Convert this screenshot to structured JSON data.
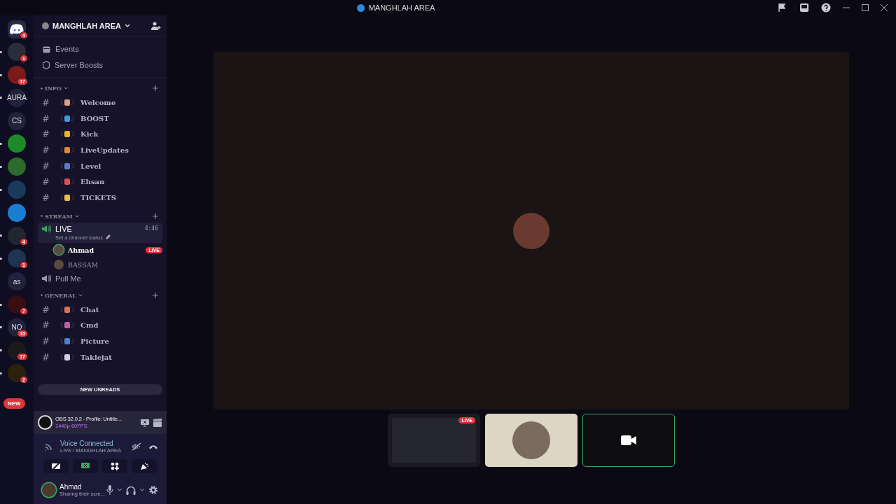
{
  "window": {
    "title": "MANGHLAH AREA"
  },
  "servers": [
    {
      "kind": "home",
      "badge": "4",
      "unread": false
    },
    {
      "kind": "image",
      "color": "#2a2d3a",
      "badge": "1",
      "unread": true
    },
    {
      "kind": "image",
      "color": "#7a1a1a",
      "badge": "17",
      "unread": true
    },
    {
      "kind": "text",
      "label": "AURA",
      "unread": true
    },
    {
      "kind": "text",
      "label": "CS",
      "unread": false
    },
    {
      "kind": "image",
      "color": "#1f8a2a",
      "unread": true
    },
    {
      "kind": "image",
      "color": "#2d6a2d",
      "unread": true
    },
    {
      "kind": "image",
      "color": "#1b3a5a",
      "unread": true
    },
    {
      "kind": "image",
      "color": "#1a7fd0",
      "unread": false
    },
    {
      "kind": "image",
      "color": "#222630",
      "badge": "4",
      "unread": true
    },
    {
      "kind": "image",
      "color": "#1d3550",
      "badge": "1",
      "unread": true
    },
    {
      "kind": "text",
      "label": "as",
      "unread": false
    },
    {
      "kind": "image",
      "color": "#3a0d12",
      "badge": "7",
      "unread": true
    },
    {
      "kind": "text",
      "label": "NO",
      "badge": "15",
      "unread": true
    },
    {
      "kind": "image",
      "color": "#1a1a1a",
      "badge": "17",
      "unread": true
    },
    {
      "kind": "image",
      "color": "#2a220a",
      "badge": "2",
      "unread": true
    }
  ],
  "new_pill": "NEW",
  "server": {
    "name": "MANGHLAH AREA",
    "links": [
      "Events",
      "Server Boosts"
    ]
  },
  "categories": [
    {
      "name": "INFO",
      "channels": [
        {
          "kind": "text",
          "prefix": "#",
          "open": "〔",
          "close": "〕",
          "color": "#e0a080",
          "name": "Welcome"
        },
        {
          "kind": "text",
          "prefix": "#",
          "open": "〔",
          "close": "〕",
          "color": "#3a9ae0",
          "name": "BOOST"
        },
        {
          "kind": "text",
          "prefix": "#",
          "open": "〔",
          "close": "〕",
          "color": "#f0b020",
          "name": "Kick"
        },
        {
          "kind": "text",
          "prefix": "#",
          "open": "〔",
          "close": "〕",
          "color": "#e08a30",
          "name": "LiveUpdates"
        },
        {
          "kind": "text",
          "prefix": "#",
          "open": "〔",
          "close": "〕",
          "color": "#5a7ad0",
          "name": "Level"
        },
        {
          "kind": "text",
          "prefix": "#",
          "open": "〔",
          "close": "〕",
          "color": "#e05050",
          "name": "Ehsan"
        },
        {
          "kind": "text",
          "prefix": "#",
          "open": "〔",
          "close": "〕",
          "color": "#e8c040",
          "name": "TICKETS"
        }
      ]
    },
    {
      "name": "STREAM",
      "channels": [
        {
          "kind": "voice",
          "name": "LIVE",
          "selected": true,
          "time": "4:46",
          "status": "Set a channel status",
          "members": [
            {
              "name": "Ahmad",
              "badge": "LIVE",
              "speaking": true
            },
            {
              "name": "BASSAM",
              "speaking": false
            }
          ]
        },
        {
          "kind": "voice",
          "name": "Pull Me",
          "selected": false
        }
      ]
    },
    {
      "name": "GENERAL",
      "channels": [
        {
          "kind": "text",
          "prefix": "#",
          "open": "〔",
          "close": "〕",
          "color": "#e07050",
          "name": "Chat"
        },
        {
          "kind": "text",
          "prefix": "#",
          "open": "〔",
          "close": "〕",
          "color": "#c060a0",
          "name": "Cmd"
        },
        {
          "kind": "text",
          "prefix": "#",
          "open": "〔",
          "close": "〕",
          "color": "#4a80d0",
          "name": "Picture"
        },
        {
          "kind": "text",
          "prefix": "#",
          "open": "〔",
          "close": "〕",
          "color": "#d0d0e0",
          "name": "Taklejat"
        }
      ]
    }
  ],
  "new_unreads": "NEW UNREADS",
  "stream_panel": {
    "title": "OBS 32.0.2 - Profile: Untitle...",
    "quality": "1440p 60FPS"
  },
  "voice": {
    "status": "Voice Connected",
    "channel": "LIVE / MANGHLAH AREA"
  },
  "user": {
    "name": "Ahmad",
    "status": "Sharing their scre..."
  },
  "tiles": [
    {
      "kind": "screen",
      "badge": "LIVE",
      "selected": false
    },
    {
      "kind": "avatar",
      "selected": false
    },
    {
      "kind": "camera",
      "selected": true
    }
  ]
}
